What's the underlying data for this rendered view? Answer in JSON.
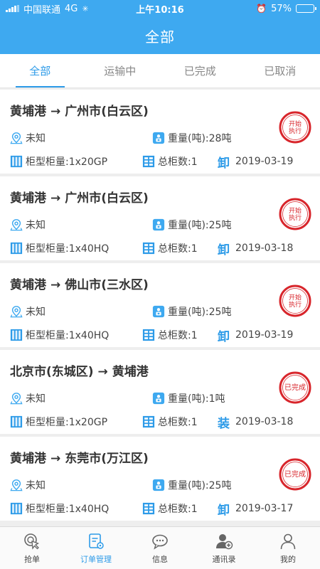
{
  "status_bar": {
    "carrier": "中国联通",
    "network": "4G",
    "time": "上午10:16",
    "battery": "57%",
    "battery_fraction": 0.57
  },
  "header": {
    "title": "全部"
  },
  "tabs": [
    {
      "label": "全部",
      "active": true
    },
    {
      "label": "运输中",
      "active": false
    },
    {
      "label": "已完成",
      "active": false
    },
    {
      "label": "已取消",
      "active": false
    }
  ],
  "labels": {
    "unknown": "未知",
    "weight": "重量(吨):",
    "container_type": "柜型柜量:",
    "total_containers": "总柜数:"
  },
  "orders": [
    {
      "from": "黄埔港",
      "arrow": "→",
      "to": "广州市(白云区)",
      "location": "未知",
      "weight": "重量(吨):28吨",
      "container": "柜型柜量:1x20GP",
      "total": "总柜数:1",
      "type_char": "卸",
      "date": "2019-03-19",
      "stamp": "开始执行"
    },
    {
      "from": "黄埔港",
      "arrow": "→",
      "to": "广州市(白云区)",
      "location": "未知",
      "weight": "重量(吨):25吨",
      "container": "柜型柜量:1x40HQ",
      "total": "总柜数:1",
      "type_char": "卸",
      "date": "2019-03-18",
      "stamp": "开始执行"
    },
    {
      "from": "黄埔港",
      "arrow": "→",
      "to": "佛山市(三水区)",
      "location": "未知",
      "weight": "重量(吨):25吨",
      "container": "柜型柜量:1x40HQ",
      "total": "总柜数:1",
      "type_char": "卸",
      "date": "2019-03-19",
      "stamp": "开始执行"
    },
    {
      "from": "北京市(东城区)",
      "arrow": "→",
      "to": "黄埔港",
      "location": "未知",
      "weight": "重量(吨):1吨",
      "container": "柜型柜量:1x20GP",
      "total": "总柜数:1",
      "type_char": "装",
      "date": "2019-03-18",
      "stamp": "已完成"
    },
    {
      "from": "黄埔港",
      "arrow": "→",
      "to": "东莞市(万江区)",
      "location": "未知",
      "weight": "重量(吨):25吨",
      "container": "柜型柜量:1x40HQ",
      "total": "总柜数:1",
      "type_char": "卸",
      "date": "2019-03-17",
      "stamp": "已完成"
    }
  ],
  "bottom_nav": [
    {
      "label": "抢单",
      "icon": "grab-order-icon",
      "active": false
    },
    {
      "label": "订单管理",
      "icon": "order-management-icon",
      "active": true
    },
    {
      "label": "信息",
      "icon": "message-icon",
      "active": false
    },
    {
      "label": "通讯录",
      "icon": "contacts-icon",
      "active": false
    },
    {
      "label": "我的",
      "icon": "profile-icon",
      "active": false
    }
  ],
  "colors": {
    "primary": "#3ea9f0",
    "accent": "#2d9be8",
    "stamp_red": "#d8262c",
    "icon_blue": "#2d9be8"
  }
}
